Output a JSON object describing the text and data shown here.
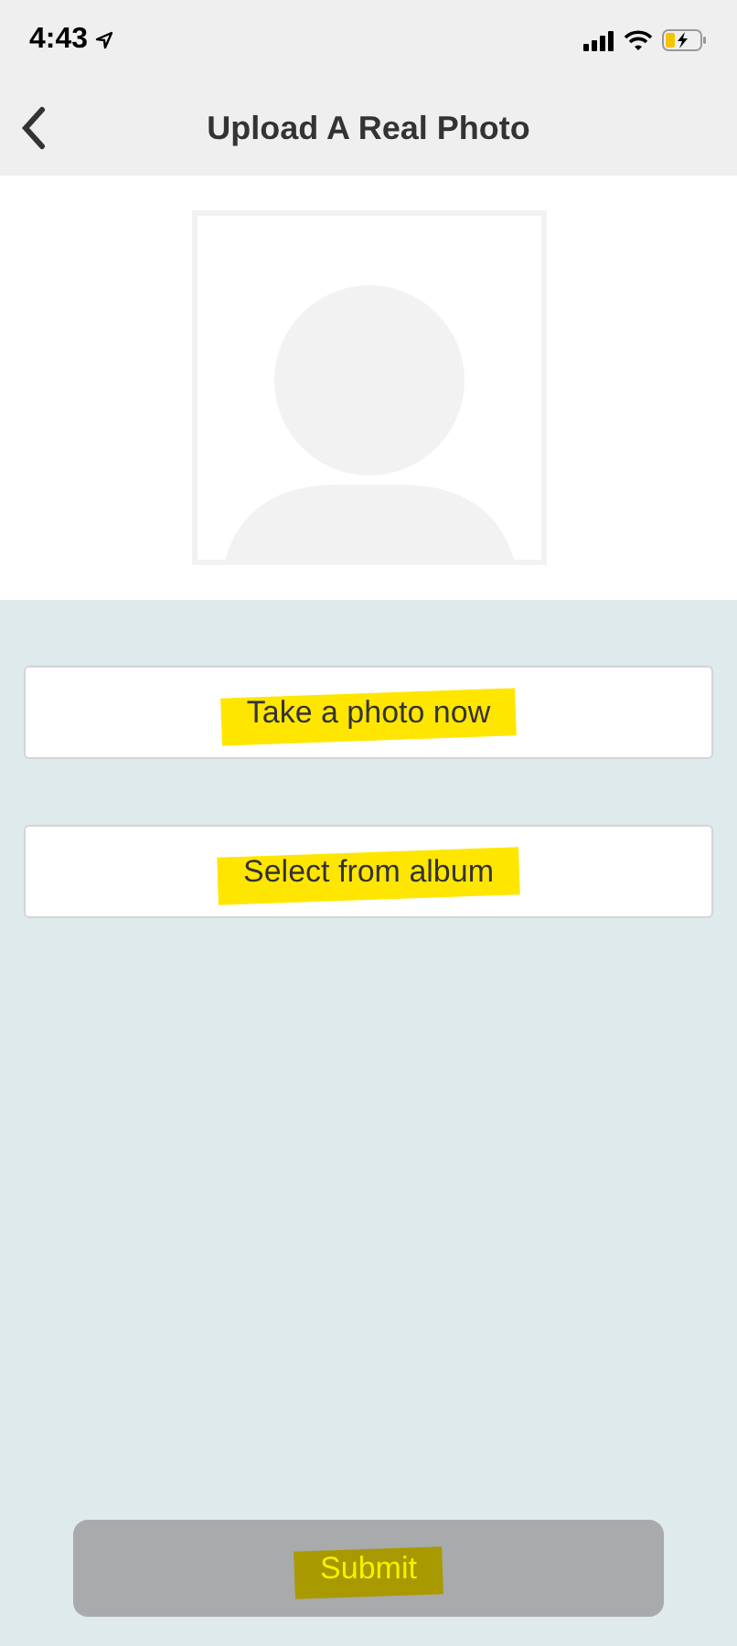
{
  "status_bar": {
    "time": "4:43"
  },
  "nav_bar": {
    "title": "Upload A Real Photo"
  },
  "options": [
    {
      "label": "Take a photo now",
      "highlighted": true
    },
    {
      "label": "Select from album",
      "highlighted": true
    }
  ],
  "submit_button": {
    "label": "Submit",
    "disabled": true,
    "highlighted": true
  }
}
